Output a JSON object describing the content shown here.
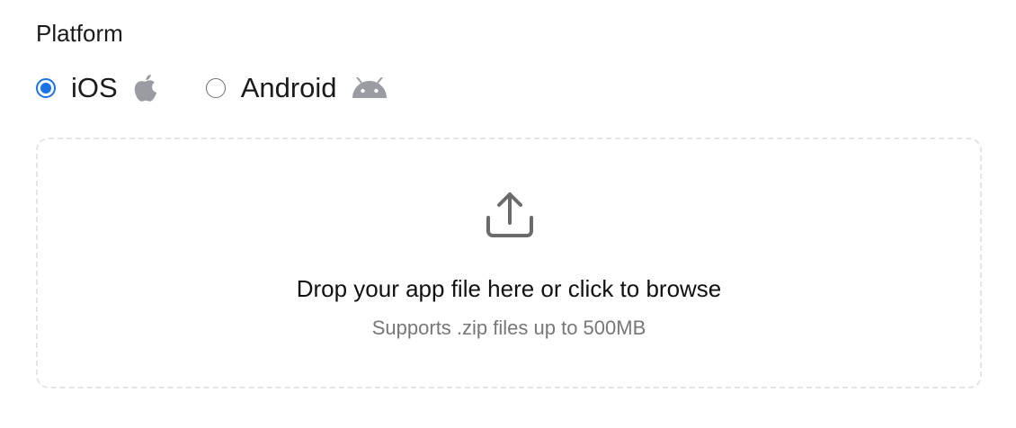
{
  "platform": {
    "label": "Platform",
    "selected": "ios",
    "options": [
      {
        "id": "ios",
        "label": "iOS",
        "icon": "apple-icon",
        "checked": true
      },
      {
        "id": "android",
        "label": "Android",
        "icon": "android-icon",
        "checked": false
      }
    ]
  },
  "upload": {
    "icon": "upload-icon",
    "title": "Drop your app file here or click to browse",
    "subtitle": "Supports .zip files up to 500MB"
  },
  "colors": {
    "accent": "#1a73e8",
    "icon_gray": "#9a9ca1",
    "upload_icon": "#6b6b6b",
    "border_dashed": "#e4e4e4"
  }
}
